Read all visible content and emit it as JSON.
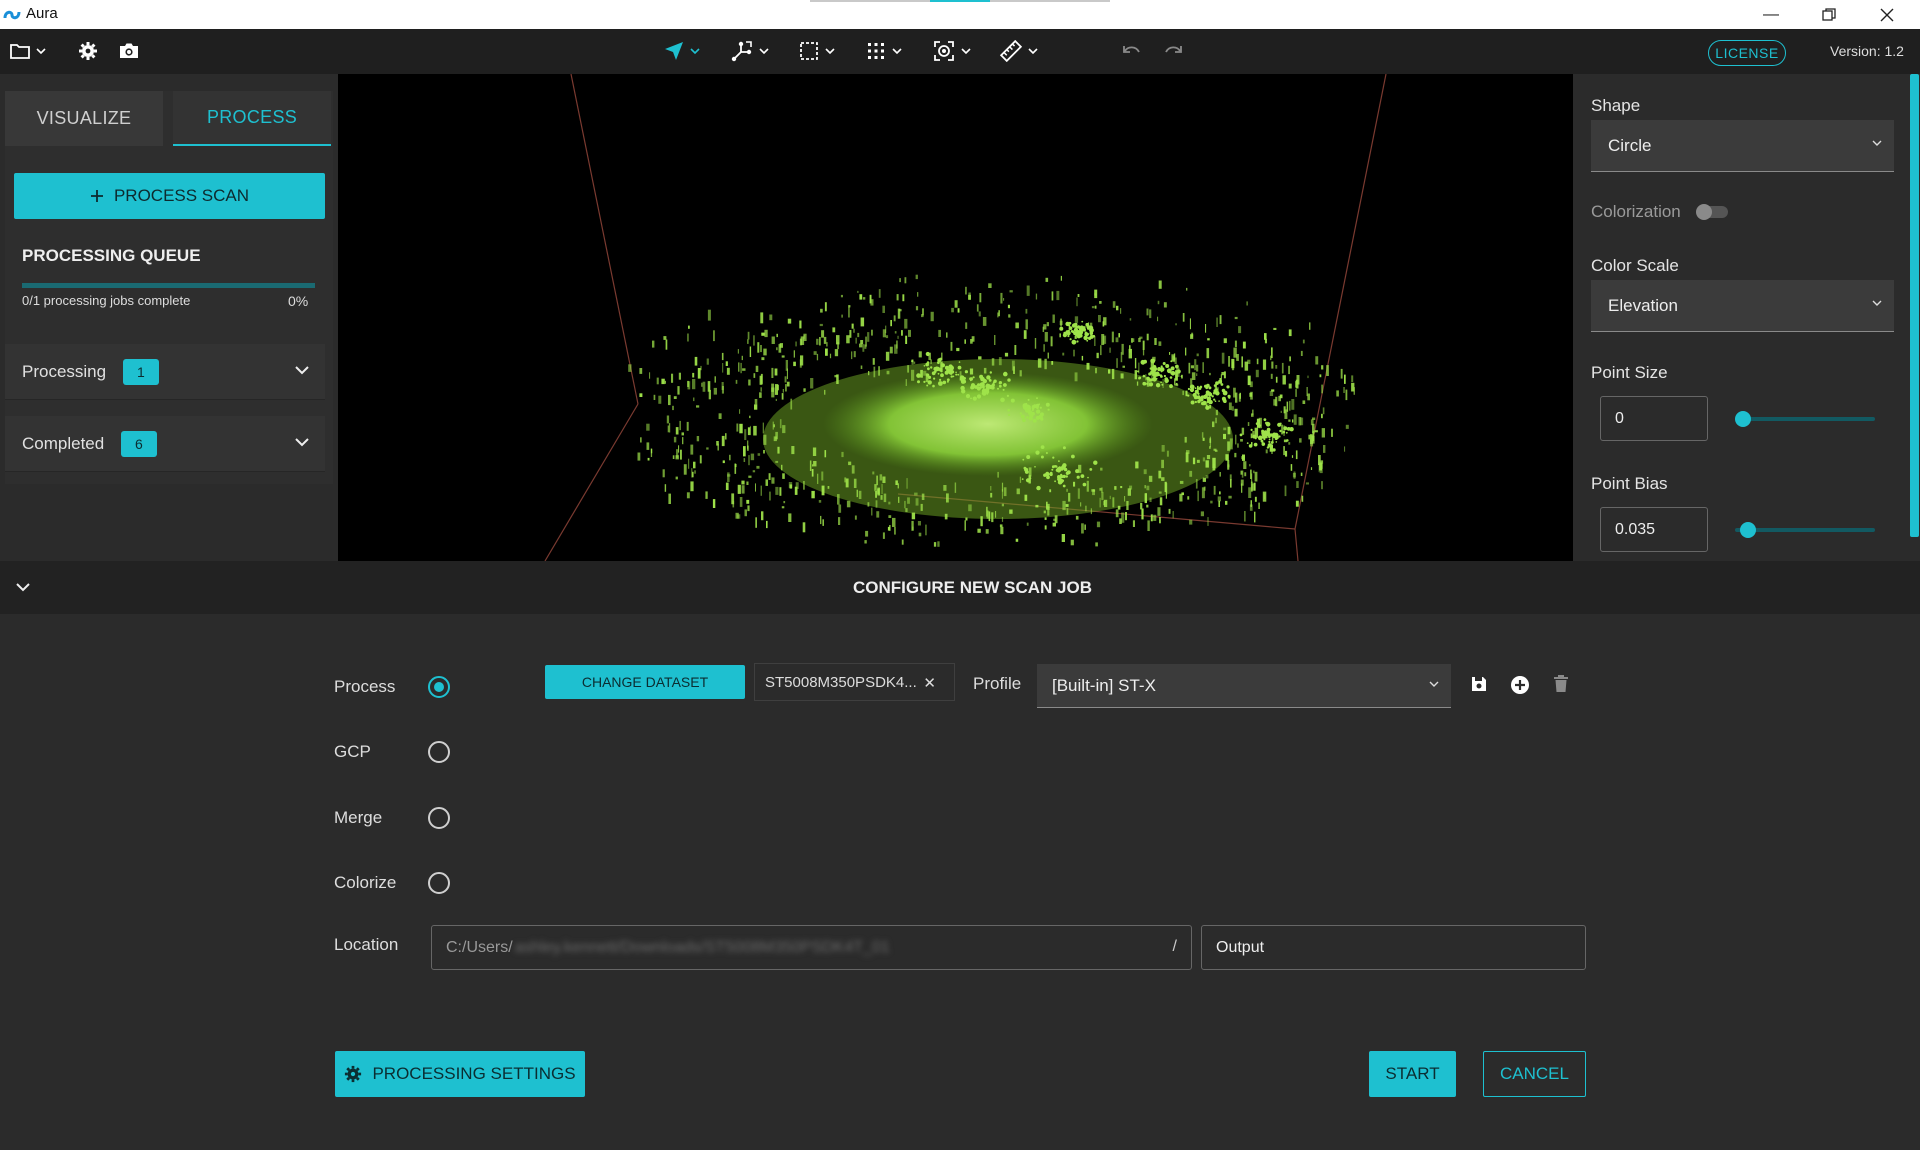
{
  "window": {
    "title": "Aura",
    "icon": "aura-logo-icon",
    "controls": [
      "minimize-icon",
      "restore-icon",
      "close-icon"
    ]
  },
  "toolbar": {
    "left_icons": [
      "folder-icon",
      "gear-icon",
      "camera-icon"
    ],
    "center_icons": [
      "navigate-arrow-icon",
      "transform-icon",
      "select-box-icon",
      "grid-icon",
      "focus-icon",
      "ruler-icon"
    ],
    "history_icons": [
      "undo-icon",
      "redo-icon"
    ],
    "license_label": "LICENSE",
    "version_label": "Version: 1.2",
    "accent_color": "#1ec0d0"
  },
  "left_panel": {
    "tabs": [
      {
        "label": "VISUALIZE",
        "active": false
      },
      {
        "label": "PROCESS",
        "active": true
      }
    ],
    "process_scan_label": "PROCESS SCAN",
    "queue": {
      "title": "PROCESSING QUEUE",
      "status": "0/1 processing jobs complete",
      "percent_label": "0%",
      "progress": 0,
      "groups": [
        {
          "label": "Processing",
          "count": "1"
        },
        {
          "label": "Completed",
          "count": "6"
        }
      ]
    }
  },
  "viewport": {
    "point_color": "#9fe34a"
  },
  "right_panel": {
    "shape_label": "Shape",
    "shape_value": "Circle",
    "colorization_label": "Colorization",
    "colorization_on": false,
    "color_scale_label": "Color Scale",
    "color_scale_value": "Elevation",
    "point_size_label": "Point Size",
    "point_size_value": "0",
    "point_size_fraction": 0.0,
    "point_bias_label": "Point Bias",
    "point_bias_value": "0.035",
    "point_bias_fraction": 0.035
  },
  "config": {
    "title": "CONFIGURE NEW SCAN JOB",
    "options": [
      {
        "label": "Process",
        "selected": true
      },
      {
        "label": "GCP",
        "selected": false
      },
      {
        "label": "Merge",
        "selected": false
      },
      {
        "label": "Colorize",
        "selected": false
      }
    ],
    "change_dataset_label": "CHANGE DATASET",
    "dataset_name": "ST5008M350PSDK4...",
    "profile_label": "Profile",
    "profile_value": "[Built-in] ST-X",
    "profile_icons": [
      "save-icon",
      "add-circle-icon",
      "trash-icon"
    ],
    "location_label": "Location",
    "location_prefix": "C:/Users/",
    "location_blurred": "ashley.kennett/Downloads/ST5008M350PSDK4T_01",
    "location_browse": "/",
    "output_value": "Output",
    "processing_settings_label": "PROCESSING SETTINGS",
    "start_label": "START",
    "cancel_label": "CANCEL"
  }
}
